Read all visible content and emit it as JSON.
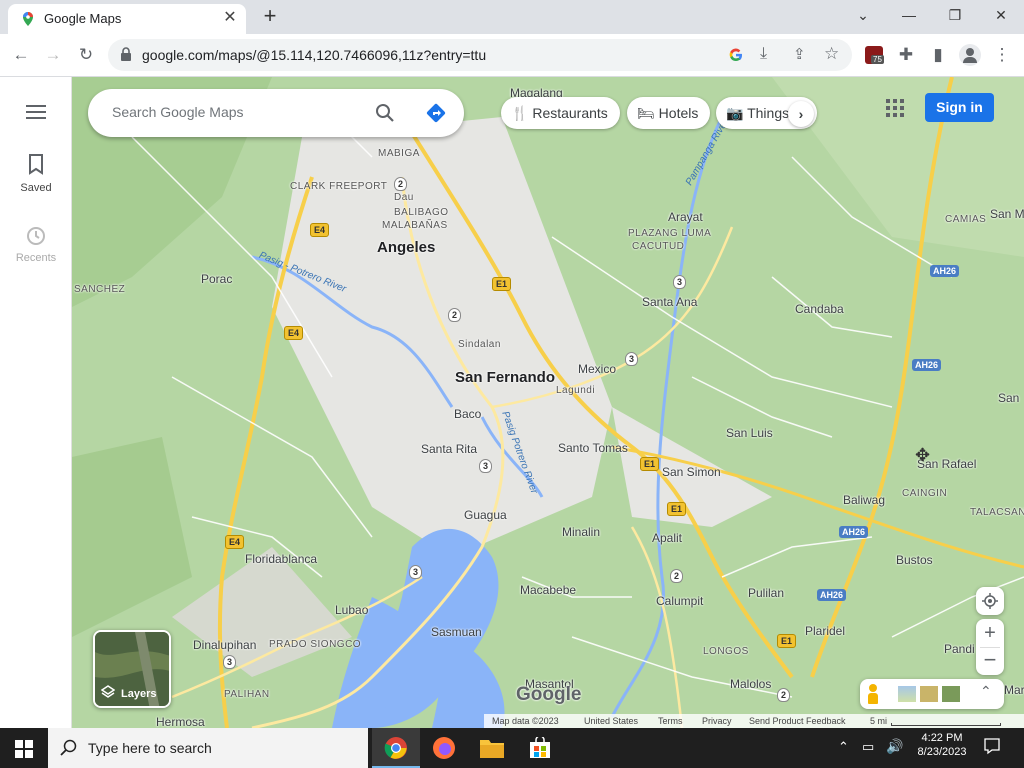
{
  "browser": {
    "tab_title": "Google Maps",
    "url": "google.com/maps/@15.114,120.7466096,11z?entry=ttu",
    "extension_badge": "75"
  },
  "sidebar": {
    "items": [
      {
        "label": "Saved",
        "icon": "bookmark-icon"
      },
      {
        "label": "Recents",
        "icon": "history-icon"
      }
    ]
  },
  "search": {
    "placeholder": "Search Google Maps"
  },
  "chips": [
    {
      "label": "Restaurants",
      "icon": "fork-knife-icon"
    },
    {
      "label": "Hotels",
      "icon": "bed-icon"
    },
    {
      "label": "Things",
      "icon": "camera-icon"
    }
  ],
  "signin_label": "Sign in",
  "layers_label": "Layers",
  "places": {
    "major": [
      "Angeles",
      "San Fernando"
    ],
    "towns": [
      "Magalang",
      "Porac",
      "Arayat",
      "Santa Ana",
      "Candaba",
      "Mexico",
      "Baco",
      "Santa Rita",
      "San Luis",
      "San Simon",
      "Santo Tomas",
      "Minalin",
      "Apalit",
      "Baliwag",
      "Floridablanca",
      "Guagua",
      "Lubao",
      "Macabebe",
      "Sasmuan",
      "Calumpit",
      "Pulilan",
      "Plaridel",
      "Dinalupihan",
      "Masantol",
      "Malolos",
      "Hermosa",
      "San Rafael",
      "Pandi",
      "Bustos",
      "Maria",
      "San M",
      "San",
      "Dau",
      "Sindalan",
      "Lagundi"
    ],
    "small": [
      "MABIGA",
      "CLARK FREEPORT",
      "BALIBAGO",
      "MALABAÑAS",
      "SANCHEZ",
      "PLAZANG LUMA",
      "CACUTUD",
      "CAMIAS",
      "CAINGIN",
      "TALACSAN",
      "LONGOS",
      "PRADO SIONGCO",
      "PALIHAN"
    ],
    "rivers": [
      "Pasig - Potrero River",
      "Pampanga River",
      "Pasig Potrero River"
    ]
  },
  "shields": {
    "e1": "E1",
    "e4": "E4",
    "ah26": "AH26",
    "n2": "2",
    "n3": "3"
  },
  "footer": {
    "map_data": "Map data ©2023",
    "country": "United States",
    "terms": "Terms",
    "privacy": "Privacy",
    "feedback": "Send Product Feedback",
    "scale": "5 mi"
  },
  "watermark": "Google",
  "taskbar": {
    "search_placeholder": "Type here to search",
    "time": "4:22 PM",
    "date": "8/23/2023"
  }
}
